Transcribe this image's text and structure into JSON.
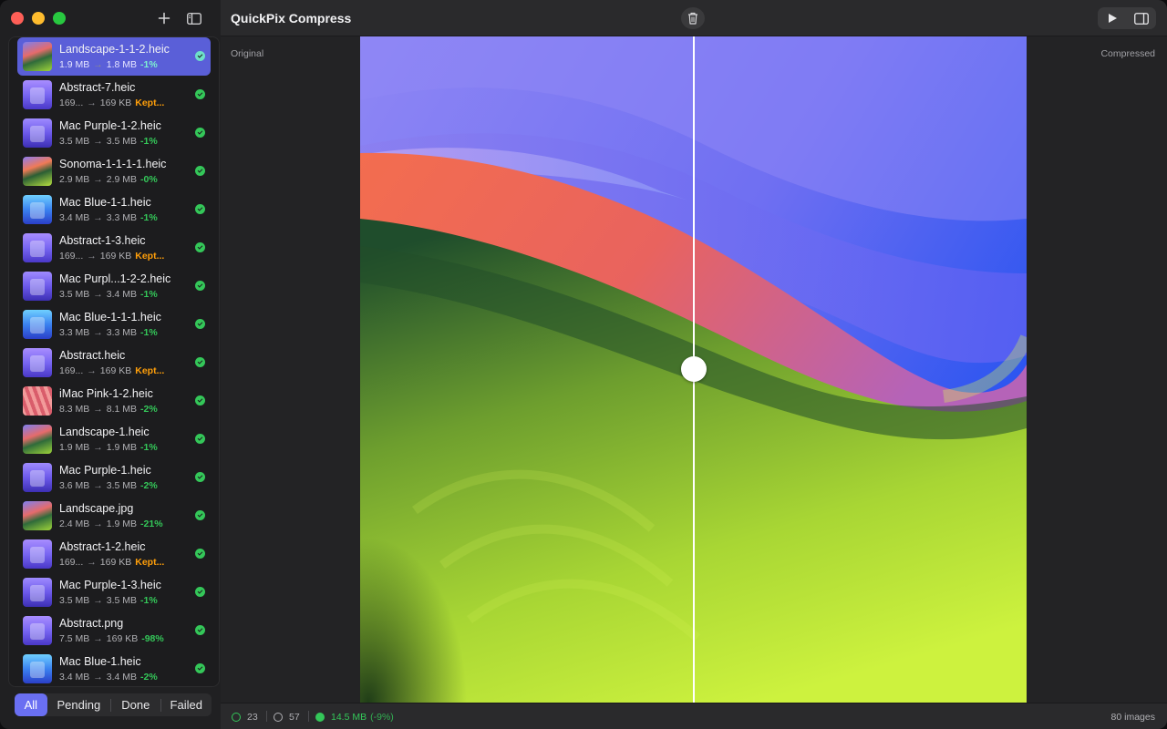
{
  "app": {
    "title": "QuickPix Compress"
  },
  "sidebar": {
    "files": [
      {
        "name": "Landscape-1-1-2.heic",
        "from": "1.9 MB",
        "to": "1.8 MB",
        "delta": "-1%",
        "kind": "landscape",
        "selected": true
      },
      {
        "name": "Abstract-7.heic",
        "from": "169...",
        "to": "169 KB",
        "delta": "Kept...",
        "kind": "abstract",
        "kept": true
      },
      {
        "name": "Mac Purple-1-2.heic",
        "from": "3.5 MB",
        "to": "3.5 MB",
        "delta": "-1%",
        "kind": "purple"
      },
      {
        "name": "Sonoma-1-1-1-1.heic",
        "from": "2.9 MB",
        "to": "2.9 MB",
        "delta": "-0%",
        "kind": "sonoma"
      },
      {
        "name": "Mac Blue-1-1.heic",
        "from": "3.4 MB",
        "to": "3.3 MB",
        "delta": "-1%",
        "kind": "blue"
      },
      {
        "name": "Abstract-1-3.heic",
        "from": "169...",
        "to": "169 KB",
        "delta": "Kept...",
        "kind": "abstract",
        "kept": true
      },
      {
        "name": "Mac Purpl...1-2-2.heic",
        "from": "3.5 MB",
        "to": "3.4 MB",
        "delta": "-1%",
        "kind": "purple"
      },
      {
        "name": "Mac Blue-1-1-1.heic",
        "from": "3.3 MB",
        "to": "3.3 MB",
        "delta": "-1%",
        "kind": "blue"
      },
      {
        "name": "Abstract.heic",
        "from": "169...",
        "to": "169 KB",
        "delta": "Kept...",
        "kind": "abstract",
        "kept": true
      },
      {
        "name": "iMac Pink-1-2.heic",
        "from": "8.3 MB",
        "to": "8.1 MB",
        "delta": "-2%",
        "kind": "pink"
      },
      {
        "name": "Landscape-1.heic",
        "from": "1.9 MB",
        "to": "1.9 MB",
        "delta": "-1%",
        "kind": "landscape"
      },
      {
        "name": "Mac Purple-1.heic",
        "from": "3.6 MB",
        "to": "3.5 MB",
        "delta": "-2%",
        "kind": "purple"
      },
      {
        "name": "Landscape.jpg",
        "from": "2.4 MB",
        "to": "1.9 MB",
        "delta": "-21%",
        "kind": "landscape"
      },
      {
        "name": "Abstract-1-2.heic",
        "from": "169...",
        "to": "169 KB",
        "delta": "Kept...",
        "kind": "abstract",
        "kept": true
      },
      {
        "name": "Mac Purple-1-3.heic",
        "from": "3.5 MB",
        "to": "3.5 MB",
        "delta": "-1%",
        "kind": "purple"
      },
      {
        "name": "Abstract.png",
        "from": "7.5 MB",
        "to": "169 KB",
        "delta": "-98%",
        "kind": "abstract"
      },
      {
        "name": "Mac Blue-1.heic",
        "from": "3.4 MB",
        "to": "3.4 MB",
        "delta": "-2%",
        "kind": "blue"
      }
    ],
    "filters": {
      "all": "All",
      "pending": "Pending",
      "done": "Done",
      "failed": "Failed"
    }
  },
  "viewer": {
    "original_label": "Original",
    "compressed_label": "Compressed"
  },
  "status": {
    "done_count": "23",
    "pending_count": "57",
    "size": "14.5 MB",
    "size_pct": "(-9%)",
    "image_count": "80 images"
  },
  "icons": {
    "add": "plus-icon",
    "sidebar": "sidebar-toggle-icon",
    "trash": "trash-icon",
    "play": "play-icon",
    "panel": "panel-right-icon"
  },
  "colors": {
    "accent": "#5a5fd8",
    "success": "#34c759",
    "warning": "#ff9f0a"
  }
}
